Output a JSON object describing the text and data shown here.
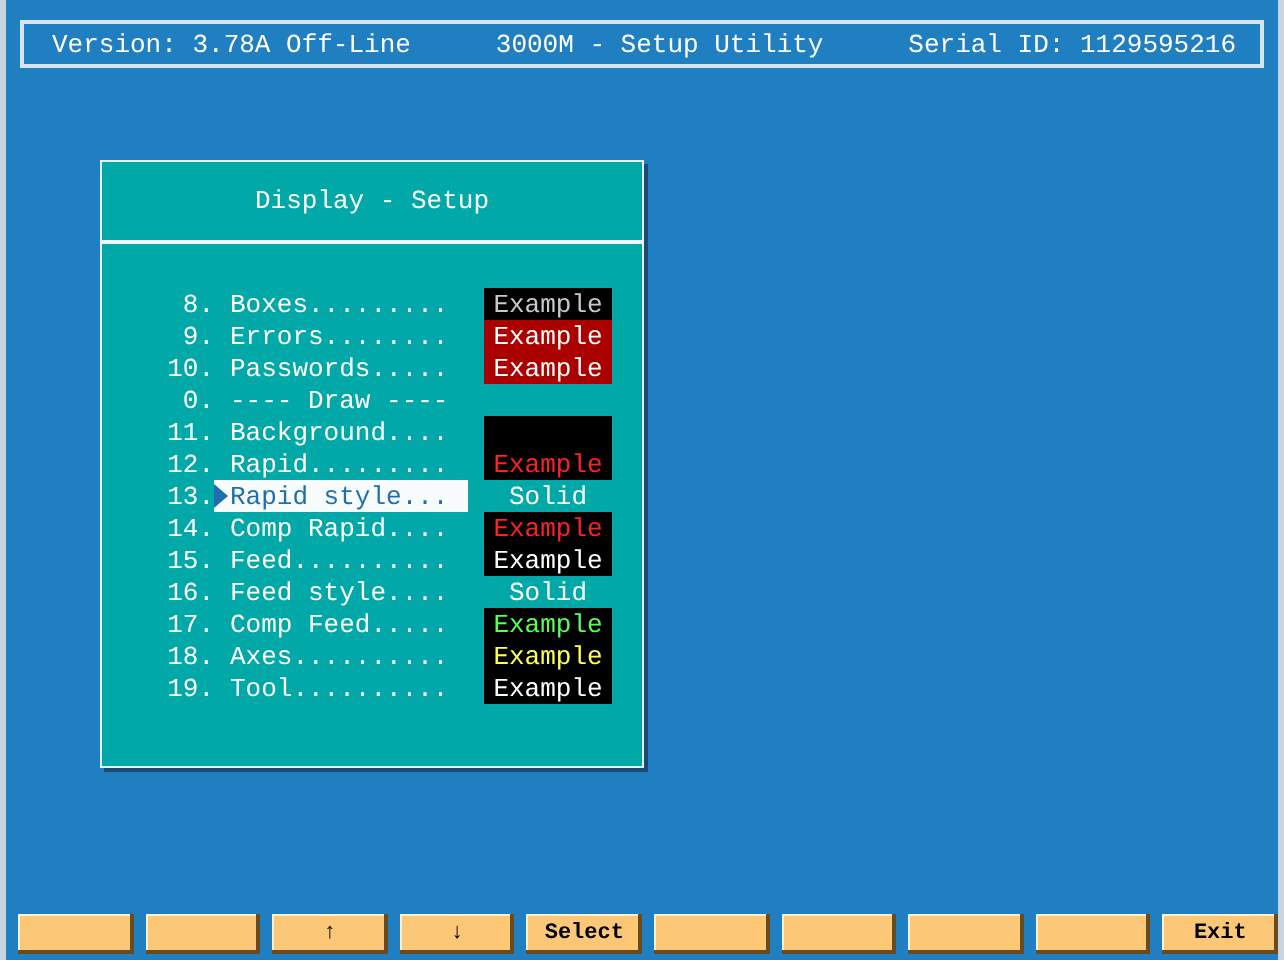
{
  "header": {
    "version": "Version: 3.78A Off-Line",
    "title": "3000M - Setup Utility",
    "serial": "Serial ID: 1129595216"
  },
  "panel": {
    "title": "Display - Setup",
    "rows": [
      {
        "kind": "option",
        "number": "8.",
        "label": "Boxes.........",
        "selected": false,
        "sample": {
          "kind": "swatch",
          "color": "#000000",
          "label": {
            "text": "Example",
            "color": "#c8c8c8"
          }
        }
      },
      {
        "kind": "option",
        "number": "9.",
        "label": "Errors........",
        "selected": false,
        "sample": {
          "kind": "swatch",
          "color": "#aa0000",
          "label": {
            "text": "Example",
            "color": "#ffffff"
          }
        }
      },
      {
        "kind": "option",
        "number": "10.",
        "label": "Passwords.....",
        "selected": false,
        "sample": {
          "kind": "swatch",
          "color": "#aa0000",
          "label": {
            "text": "Example",
            "color": "#ffffff"
          }
        }
      },
      {
        "kind": "heading",
        "number": "0.",
        "label": "---- Draw ----"
      },
      {
        "kind": "option",
        "number": "11.",
        "label": "Background....",
        "selected": false,
        "sample": {
          "kind": "swatch",
          "color": "#000000"
        }
      },
      {
        "kind": "option",
        "number": "12.",
        "label": "Rapid.........",
        "selected": false,
        "sample": {
          "kind": "swatch",
          "color": "#000000",
          "label": {
            "text": "Example",
            "color": "#ff2020"
          }
        }
      },
      {
        "kind": "option",
        "number": "13.",
        "label": "Rapid style...",
        "selected": true,
        "sample": {
          "kind": "text",
          "text": "Solid"
        }
      },
      {
        "kind": "option",
        "number": "14.",
        "label": "Comp Rapid....",
        "selected": false,
        "sample": {
          "kind": "swatch",
          "color": "#000000",
          "label": {
            "text": "Example",
            "color": "#ff2020"
          }
        }
      },
      {
        "kind": "option",
        "number": "15.",
        "label": "Feed..........",
        "selected": false,
        "sample": {
          "kind": "swatch",
          "color": "#000000",
          "label": {
            "text": "Example",
            "color": "#ffffff"
          }
        }
      },
      {
        "kind": "option",
        "number": "16.",
        "label": "Feed style....",
        "selected": false,
        "sample": {
          "kind": "text",
          "text": "Solid"
        }
      },
      {
        "kind": "option",
        "number": "17.",
        "label": "Comp Feed.....",
        "selected": false,
        "sample": {
          "kind": "swatch",
          "color": "#000000",
          "label": {
            "text": "Example",
            "color": "#55ff55"
          }
        }
      },
      {
        "kind": "option",
        "number": "18.",
        "label": "Axes..........",
        "selected": false,
        "sample": {
          "kind": "swatch",
          "color": "#000000",
          "label": {
            "text": "Example",
            "color": "#ffff55"
          }
        }
      },
      {
        "kind": "option",
        "number": "19.",
        "label": "Tool..........",
        "selected": false,
        "sample": {
          "kind": "swatch",
          "color": "#000000",
          "label": {
            "text": "Example",
            "color": "#ffffff"
          }
        }
      }
    ]
  },
  "function_keys": [
    {
      "kind": "blank"
    },
    {
      "kind": "blank"
    },
    {
      "kind": "labeled",
      "label": "↑"
    },
    {
      "kind": "labeled",
      "label": "↓"
    },
    {
      "kind": "labeled",
      "label": "Select"
    },
    {
      "kind": "blank"
    },
    {
      "kind": "blank"
    },
    {
      "kind": "blank"
    },
    {
      "kind": "blank"
    },
    {
      "kind": "labeled",
      "label": "Exit"
    }
  ]
}
